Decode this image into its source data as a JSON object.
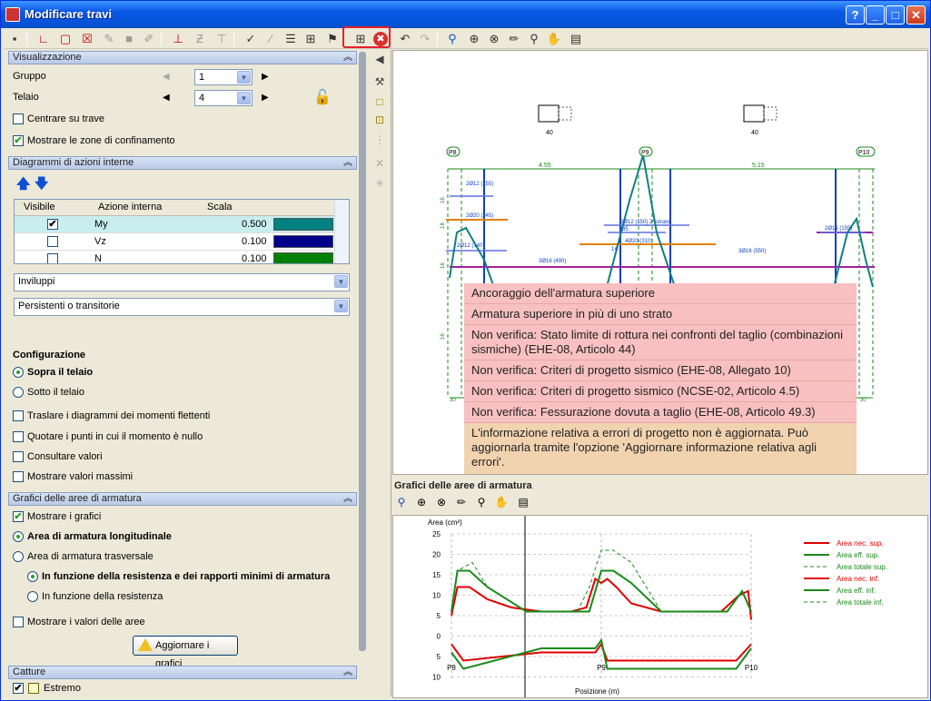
{
  "window": {
    "title": "Modificare travi",
    "help_label": "?",
    "min_label": "_",
    "max_label": "□",
    "close_label": "✕"
  },
  "colors": {
    "accent": "#0a58e6",
    "highlight": "#e8202a",
    "error_bg": "#f8c0c0",
    "info_bg": "#f2d3b0",
    "beam_line": "#1040c0",
    "green": "#1a8a1a",
    "red": "#e00000"
  },
  "sections": {
    "visualizzazione": {
      "title": "Visualizzazione",
      "gruppo_label": "Gruppo",
      "gruppo_value": "1",
      "telaio_label": "Telaio",
      "telaio_value": "4",
      "centrare_label": "Centrare su trave",
      "mostrare_zone_label": "Mostrare le zone di confinamento"
    },
    "diagrammi": {
      "title": "Diagrammi di azioni interne",
      "col_visibile": "Visibile",
      "col_azione": "Azione interna",
      "col_scala": "Scala",
      "rows": [
        {
          "checked": "✔",
          "name": "My",
          "scale": "0.500",
          "color": "#008080"
        },
        {
          "checked": "",
          "name": "Vz",
          "scale": "0.100",
          "color": "#00008b"
        },
        {
          "checked": "",
          "name": "N",
          "scale": "0.100",
          "color": "#008000"
        }
      ],
      "combo1": "Inviluppi",
      "combo2": "Persistenti o transitorie"
    },
    "configurazione": {
      "title": "Configurazione",
      "sopra": "Sopra il telaio",
      "sotto": "Sotto il telaio",
      "traslare": "Traslare i diagrammi dei momenti flettenti",
      "quotare": "Quotare i punti in cui il momento è nullo",
      "consultare": "Consultare valori",
      "massimi": "Mostrare valori massimi"
    },
    "grafici": {
      "title": "Grafici delle aree di armatura",
      "mostrare": "Mostrare i grafici",
      "longitudinale": "Area di armatura longitudinale",
      "trasversale": "Area di armatura trasversale",
      "funzione_resistenza_min": "In funzione della resistenza e dei rapporti minimi di armatura",
      "funzione_resistenza": "In funzione della resistenza",
      "valori_aree": "Mostrare i valori delle aree",
      "aggiornare": "Aggiornare i grafici"
    },
    "catture": {
      "title": "Catture",
      "estremo": "Estremo"
    }
  },
  "drawing": {
    "column_labels": [
      "P8",
      "P9",
      "P10"
    ],
    "spans": [
      "4.55",
      "5.15"
    ],
    "section_dims": [
      "40",
      "40"
    ],
    "bar_labels": [
      "2Ø12 (155)",
      "2Ø20 (245)",
      "2Ø12 (140)",
      "3Ø16 (490)",
      "2Ø12 (150) 2º strato",
      "4Ø20 (310)",
      "3Ø16 (550)",
      "2Ø16 (155)",
      "85",
      "14",
      "30",
      "30",
      "16",
      "16",
      "18",
      "16"
    ],
    "errors": [
      "Ancoraggio dell'armatura superiore",
      "Armatura superiore in più di uno strato",
      "Non verifica: Stato limite di rottura nei confronti del taglio (combinazioni sismiche) (EHE-08, Articolo 44)",
      "Non verifica: Criteri di progetto sismico (EHE-08, Allegato 10)",
      "Non verifica: Criteri di progetto sismico (NCSE-02, Articolo 4.5)",
      "Non verifica: Fessurazione dovuta a taglio (EHE-08, Articolo 49.3)"
    ],
    "info": "L'informazione relativa a errori di progetto non è aggiornata. Può aggiornarla tramite l'opzione 'Aggiornare informazione relativa agli errori'."
  },
  "chart_panel": {
    "title": "Grafici delle aree di armatura"
  },
  "chart_data": {
    "type": "line",
    "ylabel": "Area (cm²)",
    "xlabel": "Posizione (m)",
    "x_ticks": [
      "P8",
      "P9",
      "P10"
    ],
    "y_ticks_top": [
      "25",
      "20",
      "15",
      "10",
      "5",
      "0"
    ],
    "y_ticks_bottom": [
      "5",
      "10"
    ],
    "series": [
      {
        "name": "Area nec. sup.",
        "color": "#e00000",
        "style": "solid",
        "x": [
          0,
          0.02,
          0.06,
          0.12,
          0.2,
          0.3,
          0.4,
          0.45,
          0.48,
          0.5,
          0.52,
          0.55,
          0.6,
          0.7,
          0.8,
          0.9,
          0.96,
          0.99,
          1
        ],
        "y": [
          5,
          12,
          12,
          9,
          7,
          6,
          6,
          7,
          14,
          13,
          14,
          12,
          8,
          6,
          6,
          6,
          10,
          11,
          4
        ]
      },
      {
        "name": "Area eff. sup.",
        "color": "#1a8a1a",
        "style": "solid",
        "x": [
          0,
          0.02,
          0.06,
          0.12,
          0.25,
          0.35,
          0.42,
          0.46,
          0.5,
          0.54,
          0.6,
          0.7,
          0.8,
          0.92,
          0.97,
          1
        ],
        "y": [
          6,
          16,
          16,
          12,
          6,
          6,
          6,
          6,
          16,
          16,
          13,
          6,
          6,
          6,
          11,
          6
        ]
      },
      {
        "name": "Area totale sup.",
        "color": "#1a8a1a",
        "style": "dashed",
        "x": [
          0,
          0.02,
          0.07,
          0.12,
          0.25,
          0.34,
          0.42,
          0.46,
          0.5,
          0.54,
          0.6,
          0.7,
          0.8,
          0.92,
          0.97,
          1
        ],
        "y": [
          6,
          16,
          18,
          12,
          6,
          6,
          6,
          12,
          21,
          21,
          18,
          6,
          6,
          6,
          11,
          6
        ]
      },
      {
        "name": "Area nec. inf.",
        "color": "#e00000",
        "style": "solid",
        "x": [
          0,
          0.04,
          0.3,
          0.48,
          0.5,
          0.52,
          0.7,
          0.95,
          1
        ],
        "y": [
          -2,
          -6,
          -4,
          -4,
          -2,
          -6,
          -6,
          -6,
          -2
        ]
      },
      {
        "name": "Area eff. inf.",
        "color": "#1a8a1a",
        "style": "solid",
        "x": [
          0,
          0.04,
          0.3,
          0.48,
          0.5,
          0.52,
          0.7,
          0.95,
          1
        ],
        "y": [
          -4,
          -8,
          -3,
          -3,
          -1,
          -8,
          -8,
          -8,
          -3
        ]
      },
      {
        "name": "Area totale inf.",
        "color": "#1a8a1a",
        "style": "dashed",
        "x": [
          0,
          0.04,
          0.3,
          0.48,
          0.5,
          0.52,
          0.7,
          0.95,
          1
        ],
        "y": [
          -4,
          -8,
          -3,
          -3,
          -1,
          -8,
          -8,
          -8,
          -3
        ]
      }
    ],
    "ylim": [
      -11,
      25
    ],
    "grid": true,
    "legend_position": "right"
  }
}
